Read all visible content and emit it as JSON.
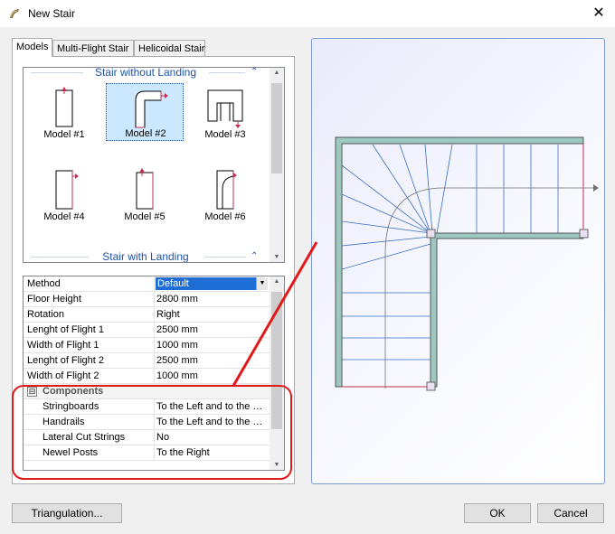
{
  "window": {
    "title": "New Stair",
    "close_glyph": "✕"
  },
  "tabs": [
    "Models",
    "Multi-Flight Stair",
    "Helicoidal Stair"
  ],
  "models": {
    "groups": [
      {
        "title": "Stair without Landing",
        "collapse_glyph": "⌃"
      },
      {
        "title": "Stair with Landing",
        "collapse_glyph": "⌃"
      }
    ],
    "items": [
      {
        "label": "Model #1",
        "icon": "straight-stair-icon",
        "selected": false
      },
      {
        "label": "Model #2",
        "icon": "l-shaped-stair-icon",
        "selected": true
      },
      {
        "label": "Model #3",
        "icon": "u-shaped-stair-icon",
        "selected": false
      },
      {
        "label": "Model #4",
        "icon": "straight-stair-turn-icon",
        "selected": false
      },
      {
        "label": "Model #5",
        "icon": "straight-stair-arrow-icon",
        "selected": false
      },
      {
        "label": "Model #6",
        "icon": "curved-stair-icon",
        "selected": false
      }
    ]
  },
  "properties": {
    "rows": [
      {
        "name": "Method",
        "value": "Default"
      },
      {
        "name": "Floor Height",
        "value": "2800 mm"
      },
      {
        "name": "Rotation",
        "value": "Right"
      },
      {
        "name": "Lenght of Flight 1",
        "value": "2500 mm"
      },
      {
        "name": "Width of Flight 1",
        "value": "1000 mm"
      },
      {
        "name": "Lenght of Flight 2",
        "value": "2500 mm"
      },
      {
        "name": "Width of Flight 2",
        "value": "1000 mm"
      }
    ],
    "category": {
      "name": "Components",
      "toggle": "⊟"
    },
    "sub_rows": [
      {
        "name": "Stringboards",
        "value": "To the Left and to the Right"
      },
      {
        "name": "Handrails",
        "value": "To the Left and to the Right"
      },
      {
        "name": "Lateral Cut Strings",
        "value": "No"
      },
      {
        "name": "Newel Posts",
        "value": "To the Right"
      }
    ]
  },
  "buttons": {
    "triangulation": "Triangulation...",
    "ok": "OK",
    "cancel": "Cancel"
  },
  "colors": {
    "accent": "#1c52a8",
    "stringer": "#9dc8c0",
    "annotation": "#e11919",
    "selection": "#1e6ed6"
  }
}
